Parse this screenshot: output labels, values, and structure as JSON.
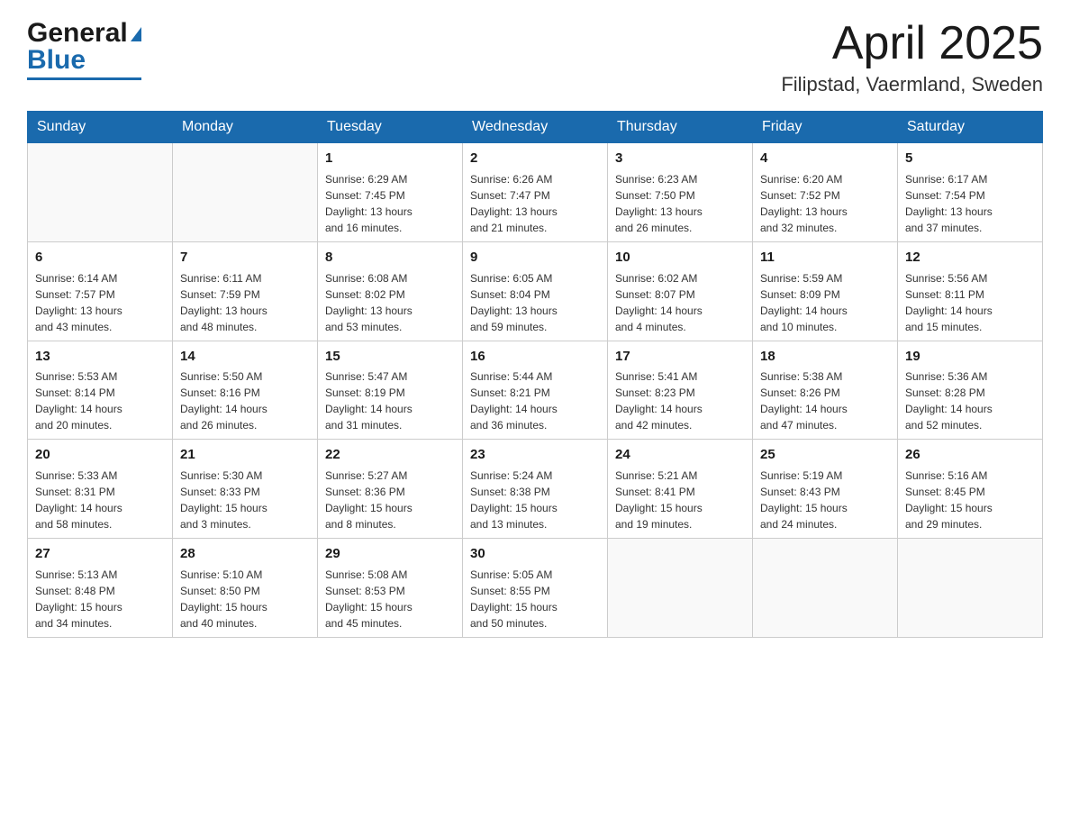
{
  "header": {
    "logo_general": "General",
    "logo_blue": "Blue",
    "month_title": "April 2025",
    "location": "Filipstad, Vaermland, Sweden"
  },
  "days_of_week": [
    "Sunday",
    "Monday",
    "Tuesday",
    "Wednesday",
    "Thursday",
    "Friday",
    "Saturday"
  ],
  "weeks": [
    [
      {
        "day": "",
        "info": ""
      },
      {
        "day": "",
        "info": ""
      },
      {
        "day": "1",
        "info": "Sunrise: 6:29 AM\nSunset: 7:45 PM\nDaylight: 13 hours\nand 16 minutes."
      },
      {
        "day": "2",
        "info": "Sunrise: 6:26 AM\nSunset: 7:47 PM\nDaylight: 13 hours\nand 21 minutes."
      },
      {
        "day": "3",
        "info": "Sunrise: 6:23 AM\nSunset: 7:50 PM\nDaylight: 13 hours\nand 26 minutes."
      },
      {
        "day": "4",
        "info": "Sunrise: 6:20 AM\nSunset: 7:52 PM\nDaylight: 13 hours\nand 32 minutes."
      },
      {
        "day": "5",
        "info": "Sunrise: 6:17 AM\nSunset: 7:54 PM\nDaylight: 13 hours\nand 37 minutes."
      }
    ],
    [
      {
        "day": "6",
        "info": "Sunrise: 6:14 AM\nSunset: 7:57 PM\nDaylight: 13 hours\nand 43 minutes."
      },
      {
        "day": "7",
        "info": "Sunrise: 6:11 AM\nSunset: 7:59 PM\nDaylight: 13 hours\nand 48 minutes."
      },
      {
        "day": "8",
        "info": "Sunrise: 6:08 AM\nSunset: 8:02 PM\nDaylight: 13 hours\nand 53 minutes."
      },
      {
        "day": "9",
        "info": "Sunrise: 6:05 AM\nSunset: 8:04 PM\nDaylight: 13 hours\nand 59 minutes."
      },
      {
        "day": "10",
        "info": "Sunrise: 6:02 AM\nSunset: 8:07 PM\nDaylight: 14 hours\nand 4 minutes."
      },
      {
        "day": "11",
        "info": "Sunrise: 5:59 AM\nSunset: 8:09 PM\nDaylight: 14 hours\nand 10 minutes."
      },
      {
        "day": "12",
        "info": "Sunrise: 5:56 AM\nSunset: 8:11 PM\nDaylight: 14 hours\nand 15 minutes."
      }
    ],
    [
      {
        "day": "13",
        "info": "Sunrise: 5:53 AM\nSunset: 8:14 PM\nDaylight: 14 hours\nand 20 minutes."
      },
      {
        "day": "14",
        "info": "Sunrise: 5:50 AM\nSunset: 8:16 PM\nDaylight: 14 hours\nand 26 minutes."
      },
      {
        "day": "15",
        "info": "Sunrise: 5:47 AM\nSunset: 8:19 PM\nDaylight: 14 hours\nand 31 minutes."
      },
      {
        "day": "16",
        "info": "Sunrise: 5:44 AM\nSunset: 8:21 PM\nDaylight: 14 hours\nand 36 minutes."
      },
      {
        "day": "17",
        "info": "Sunrise: 5:41 AM\nSunset: 8:23 PM\nDaylight: 14 hours\nand 42 minutes."
      },
      {
        "day": "18",
        "info": "Sunrise: 5:38 AM\nSunset: 8:26 PM\nDaylight: 14 hours\nand 47 minutes."
      },
      {
        "day": "19",
        "info": "Sunrise: 5:36 AM\nSunset: 8:28 PM\nDaylight: 14 hours\nand 52 minutes."
      }
    ],
    [
      {
        "day": "20",
        "info": "Sunrise: 5:33 AM\nSunset: 8:31 PM\nDaylight: 14 hours\nand 58 minutes."
      },
      {
        "day": "21",
        "info": "Sunrise: 5:30 AM\nSunset: 8:33 PM\nDaylight: 15 hours\nand 3 minutes."
      },
      {
        "day": "22",
        "info": "Sunrise: 5:27 AM\nSunset: 8:36 PM\nDaylight: 15 hours\nand 8 minutes."
      },
      {
        "day": "23",
        "info": "Sunrise: 5:24 AM\nSunset: 8:38 PM\nDaylight: 15 hours\nand 13 minutes."
      },
      {
        "day": "24",
        "info": "Sunrise: 5:21 AM\nSunset: 8:41 PM\nDaylight: 15 hours\nand 19 minutes."
      },
      {
        "day": "25",
        "info": "Sunrise: 5:19 AM\nSunset: 8:43 PM\nDaylight: 15 hours\nand 24 minutes."
      },
      {
        "day": "26",
        "info": "Sunrise: 5:16 AM\nSunset: 8:45 PM\nDaylight: 15 hours\nand 29 minutes."
      }
    ],
    [
      {
        "day": "27",
        "info": "Sunrise: 5:13 AM\nSunset: 8:48 PM\nDaylight: 15 hours\nand 34 minutes."
      },
      {
        "day": "28",
        "info": "Sunrise: 5:10 AM\nSunset: 8:50 PM\nDaylight: 15 hours\nand 40 minutes."
      },
      {
        "day": "29",
        "info": "Sunrise: 5:08 AM\nSunset: 8:53 PM\nDaylight: 15 hours\nand 45 minutes."
      },
      {
        "day": "30",
        "info": "Sunrise: 5:05 AM\nSunset: 8:55 PM\nDaylight: 15 hours\nand 50 minutes."
      },
      {
        "day": "",
        "info": ""
      },
      {
        "day": "",
        "info": ""
      },
      {
        "day": "",
        "info": ""
      }
    ]
  ]
}
